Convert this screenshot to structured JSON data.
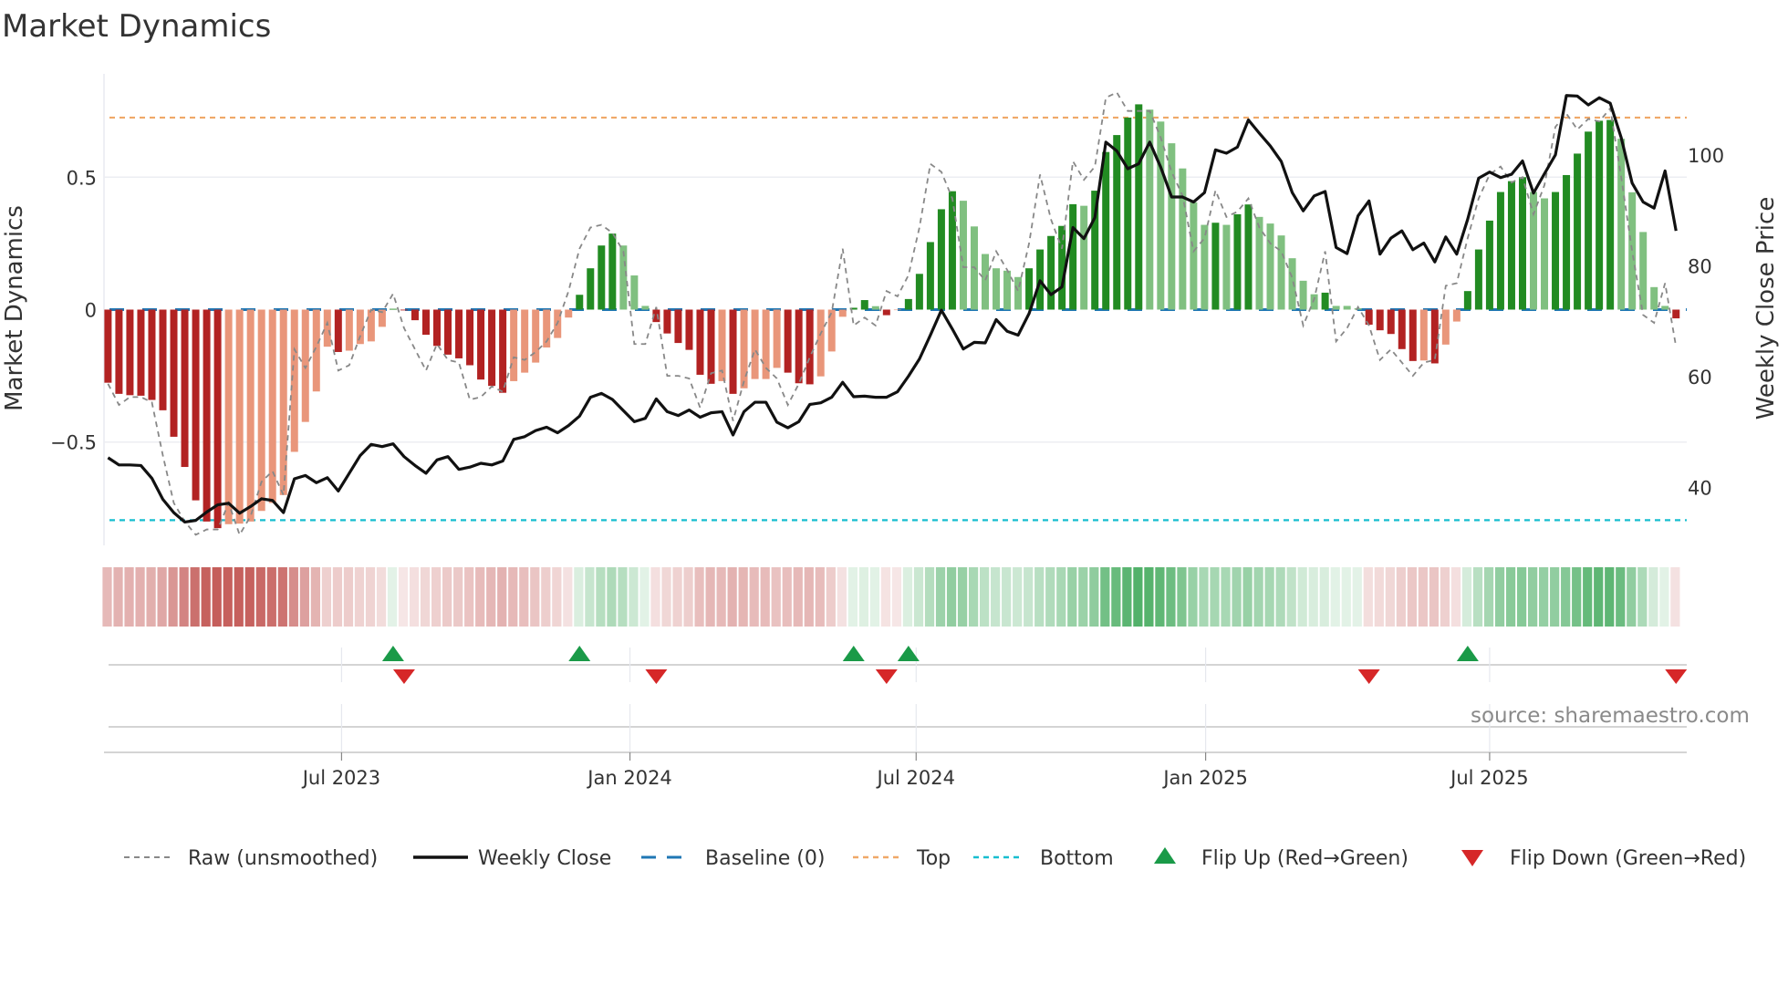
{
  "chart_data": {
    "type": "bar",
    "title": "Market Dynamics",
    "ylabel": "Market Dynamics",
    "y2label": "Weekly Close Price",
    "source": "source: sharemaestro.com",
    "x_unit": "week index (weekly bars)",
    "ylim": [
      -0.89,
      0.89
    ],
    "y2lim": [
      29.6,
      114.6
    ],
    "yticks": [
      {
        "v": 0.5,
        "label": "0.5"
      },
      {
        "v": 0,
        "label": "0"
      },
      {
        "v": -0.5,
        "label": "−0.5"
      }
    ],
    "y2ticks": [
      {
        "v": 40,
        "label": "40"
      },
      {
        "v": 60,
        "label": "60"
      },
      {
        "v": 80,
        "label": "80"
      },
      {
        "v": 100,
        "label": "100"
      }
    ],
    "xticks": [
      {
        "x": 21.3,
        "label": "Jul 2023"
      },
      {
        "x": 47.6,
        "label": "Jan 2024"
      },
      {
        "x": 73.7,
        "label": "Jul 2024"
      },
      {
        "x": 100.1,
        "label": "Jan 2025"
      },
      {
        "x": 126.0,
        "label": "Jul 2025"
      }
    ],
    "levels": {
      "top": 0.725,
      "bottom": -0.795,
      "baseline": 0
    },
    "colors": {
      "pos_strong": "#228b22",
      "pos_weak": "#80c080",
      "neg_strong": "#b22222",
      "neg_weak": "#e9967a",
      "close": "#111111",
      "raw": "#888888",
      "baseline": "#1f77b4",
      "top": "#f0a868",
      "bottom": "#17becf",
      "flip_up": "#1a9a48",
      "flip_down": "#d62728",
      "heat_pos": "#3aa655",
      "heat_neg": "#c0504d"
    },
    "momentum": [
      -0.276,
      -0.318,
      -0.323,
      -0.325,
      -0.341,
      -0.38,
      -0.48,
      -0.594,
      -0.72,
      -0.8,
      -0.825,
      -0.81,
      -0.808,
      -0.8,
      -0.76,
      -0.73,
      -0.7,
      -0.537,
      -0.424,
      -0.309,
      -0.14,
      -0.16,
      -0.155,
      -0.13,
      -0.12,
      -0.065,
      0.003,
      -0.003,
      -0.04,
      -0.095,
      -0.137,
      -0.17,
      -0.184,
      -0.21,
      -0.264,
      -0.288,
      -0.314,
      -0.27,
      -0.238,
      -0.2,
      -0.143,
      -0.107,
      -0.03,
      0.056,
      0.156,
      0.242,
      0.287,
      0.242,
      0.129,
      0.014,
      -0.047,
      -0.09,
      -0.126,
      -0.152,
      -0.246,
      -0.28,
      -0.27,
      -0.318,
      -0.297,
      -0.262,
      -0.262,
      -0.22,
      -0.238,
      -0.278,
      -0.282,
      -0.252,
      -0.158,
      -0.027,
      0.007,
      0.036,
      0.013,
      -0.021,
      -0.002,
      0.04,
      0.135,
      0.255,
      0.379,
      0.447,
      0.411,
      0.314,
      0.21,
      0.156,
      0.147,
      0.123,
      0.156,
      0.227,
      0.278,
      0.316,
      0.398,
      0.392,
      0.449,
      0.595,
      0.659,
      0.725,
      0.775,
      0.755,
      0.71,
      0.628,
      0.533,
      0.405,
      0.32,
      0.328,
      0.32,
      0.36,
      0.397,
      0.35,
      0.325,
      0.28,
      0.194,
      0.109,
      0.058,
      0.064,
      0.014,
      0.014,
      0.005,
      -0.057,
      -0.078,
      -0.092,
      -0.149,
      -0.194,
      -0.192,
      -0.203,
      -0.132,
      -0.045,
      0.07,
      0.227,
      0.336,
      0.444,
      0.485,
      0.5,
      0.444,
      0.42,
      0.444,
      0.508,
      0.589,
      0.672,
      0.713,
      0.716,
      0.645,
      0.443,
      0.293,
      0.085,
      0.014,
      -0.033
    ],
    "raw": [
      -0.28,
      -0.36,
      -0.33,
      -0.33,
      -0.35,
      -0.55,
      -0.73,
      -0.8,
      -0.85,
      -0.83,
      -0.83,
      -0.73,
      -0.85,
      -0.78,
      -0.65,
      -0.61,
      -0.7,
      -0.15,
      -0.22,
      -0.14,
      -0.05,
      -0.23,
      -0.21,
      -0.1,
      0.0,
      -0.01,
      0.06,
      -0.07,
      -0.15,
      -0.23,
      -0.13,
      -0.19,
      -0.2,
      -0.34,
      -0.33,
      -0.29,
      -0.31,
      -0.18,
      -0.19,
      -0.16,
      -0.12,
      -0.05,
      0.07,
      0.23,
      0.31,
      0.32,
      0.29,
      0.22,
      -0.13,
      -0.13,
      0.01,
      -0.25,
      -0.25,
      -0.26,
      -0.37,
      -0.24,
      -0.23,
      -0.42,
      -0.27,
      -0.15,
      -0.22,
      -0.26,
      -0.36,
      -0.28,
      -0.18,
      -0.09,
      -0.01,
      0.23,
      -0.06,
      -0.03,
      -0.06,
      0.07,
      0.05,
      0.13,
      0.31,
      0.55,
      0.52,
      0.42,
      0.16,
      0.16,
      0.11,
      0.22,
      0.15,
      0.07,
      0.25,
      0.51,
      0.34,
      0.23,
      0.56,
      0.49,
      0.54,
      0.8,
      0.82,
      0.75,
      0.75,
      0.75,
      0.65,
      0.52,
      0.43,
      0.22,
      0.27,
      0.45,
      0.35,
      0.37,
      0.42,
      0.31,
      0.25,
      0.22,
      0.12,
      -0.06,
      0.04,
      0.22,
      -0.12,
      -0.07,
      0.01,
      -0.06,
      -0.19,
      -0.15,
      -0.2,
      -0.25,
      -0.2,
      -0.19,
      0.09,
      0.1,
      0.27,
      0.42,
      0.51,
      0.54,
      0.48,
      0.5,
      0.36,
      0.47,
      0.69,
      0.74,
      0.68,
      0.72,
      0.71,
      0.76,
      0.5,
      0.22,
      -0.02,
      -0.05,
      0.1,
      -0.14
    ],
    "weekly_close": [
      45.4,
      44.1,
      44.1,
      44.0,
      41.7,
      37.9,
      35.5,
      33.8,
      34.1,
      35.6,
      36.9,
      37.2,
      35.4,
      36.6,
      38.0,
      37.7,
      35.5,
      41.6,
      42.2,
      40.9,
      41.8,
      39.4,
      42.6,
      45.8,
      47.8,
      47.4,
      47.9,
      45.6,
      44.0,
      42.6,
      45.0,
      45.6,
      43.3,
      43.7,
      44.4,
      44.1,
      44.8,
      48.7,
      49.2,
      50.3,
      50.9,
      49.9,
      51.2,
      52.9,
      56.3,
      57.0,
      55.9,
      53.9,
      51.9,
      52.5,
      56.0,
      53.7,
      53.0,
      54.0,
      52.7,
      53.5,
      53.7,
      49.5,
      53.7,
      55.4,
      55.4,
      51.8,
      50.8,
      51.9,
      55.0,
      55.3,
      56.3,
      59.0,
      56.4,
      56.5,
      56.3,
      56.3,
      57.3,
      60.1,
      63.2,
      67.5,
      72.0,
      68.6,
      65.0,
      66.2,
      66.1,
      70.3,
      68.2,
      67.5,
      71.4,
      77.3,
      74.8,
      76.2,
      86.9,
      84.9,
      88.7,
      102.3,
      100.7,
      97.5,
      98.4,
      102.3,
      97.8,
      92.4,
      92.4,
      91.5,
      93.2,
      100.9,
      100.3,
      101.4,
      106.3,
      103.9,
      101.6,
      98.8,
      93.2,
      89.9,
      92.6,
      93.4,
      83.3,
      82.2,
      89.0,
      91.7,
      82.1,
      85.0,
      86.3,
      82.9,
      84.1,
      80.7,
      85.2,
      82.1,
      88.4,
      95.8,
      96.9,
      95.9,
      96.5,
      98.9,
      93.1,
      96.6,
      100.0,
      110.7,
      110.6,
      109.0,
      110.3,
      109.3,
      103.1,
      94.9,
      91.5,
      90.4,
      97.1,
      86.3
    ],
    "flip_up": [
      26,
      43,
      68,
      73,
      124
    ],
    "flip_down": [
      27,
      50,
      71,
      115,
      143
    ],
    "legend": {
      "raw": "Raw (unsmoothed)",
      "close": "Weekly Close",
      "baseline": "Baseline (0)",
      "top": "Top",
      "bottom": "Bottom",
      "flip_up": "Flip Up (Red→Green)",
      "flip_down": "Flip Down (Green→Red)"
    },
    "legend_position": "bottom"
  }
}
